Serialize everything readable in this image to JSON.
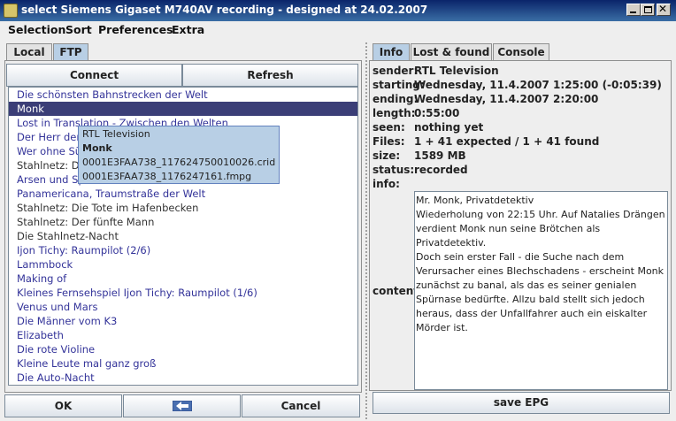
{
  "window": {
    "title": "select Siemens Gigaset M740AV recording - designed at 24.02.2007"
  },
  "menu": [
    "Selection",
    "Sort",
    "Preferences",
    "Extra"
  ],
  "left_tabs": [
    "Local",
    "FTP"
  ],
  "left_toolbar": {
    "connect": "Connect",
    "refresh": "Refresh"
  },
  "recordings": [
    "Die schönsten Bahnstrecken der Welt",
    "Monk",
    "Lost in Translation - Zwischen den Welten",
    "Der Herr der",
    "Wer ohne Sü",
    "Stahlnetz: Da",
    "Arsen und Sp",
    "Panamericana, Traumstraße der Welt",
    "Stahlnetz: Die Tote im Hafenbecken",
    "Stahlnetz: Der fünfte Mann",
    "Die Stahlnetz-Nacht",
    "Ijon Tichy: Raumpilot (2/6)",
    "Lammbock",
    "Making of",
    "Kleines Fernsehspiel Ijon Tichy: Raumpilot (1/6)",
    "Venus und Mars",
    "Die Männer vom K3",
    "Elizabeth",
    "Die rote Violine",
    "Kleine Leute mal ganz groß",
    "Die Auto-Nacht"
  ],
  "tooltip": {
    "sender": "RTL Television",
    "title": "Monk",
    "file1": "0001E3FAA738_117624750010026.crid",
    "file2": "0001E3FAA738_1176247161.fmpg"
  },
  "bottom_buttons": {
    "ok": "OK",
    "cancel": "Cancel"
  },
  "right_tabs": [
    "Info",
    "Lost & found",
    "Console"
  ],
  "info": {
    "labels": {
      "sender": "sender:",
      "starting": "starting:",
      "ending": "ending:",
      "length": "length:",
      "seen": "seen:",
      "files": "Files:",
      "size": "size:",
      "status": "status:",
      "info": "info:",
      "content": "content:"
    },
    "sender": "RTL Television",
    "starting": "Wednesday, 11.4.2007 1:25:00 (-0:05:39)",
    "ending": "Wednesday, 11.4.2007 2:20:00",
    "length": "0:55:00",
    "seen": "nothing yet",
    "files": "1 + 41 expected / 1 + 41 found",
    "size": "1589 MB",
    "status": "recorded",
    "content_lines": [
      "Mr. Monk, Privatdetektiv",
      "Wiederholung von 22:15 Uhr. Auf Natalies Drängen",
      "verdient Monk nun seine Brötchen als Privatdetektiv.",
      "Doch sein erster Fall - die Suche nach dem",
      "Verursacher eines Blechschadens - erscheint Monk",
      "zunächst zu banal, als das es seiner genialen",
      "Spürnase bedürfte. Allzu bald stellt sich jedoch",
      "heraus, dass der Unfallfahrer auch ein eiskalter",
      "Mörder ist."
    ]
  },
  "save_epg": "save EPG",
  "colors": {
    "selected_row": "#3b3e77",
    "list_text": "#333399",
    "tab_active": "#b8cfe5"
  }
}
